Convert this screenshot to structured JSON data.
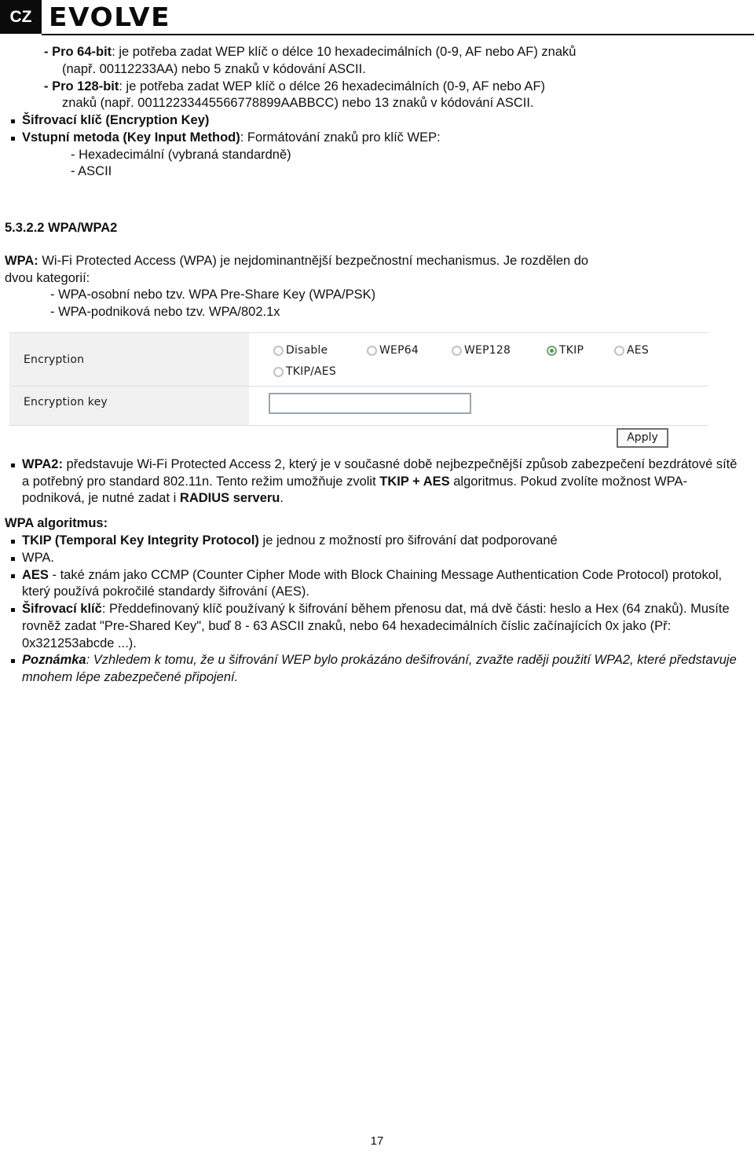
{
  "header": {
    "country_badge": "CZ",
    "brand": "EVOLVE"
  },
  "wep_key_lengths": {
    "bit64": {
      "label": "- Pro 64-bit",
      "line1_rest": ": je potřeba zadat WEP klíč o délce 10 hexadecimálních (0-9, AF nebo AF) znaků",
      "line2": "(např. 00112233AA) nebo 5 znaků v kódování ASCII."
    },
    "bit128": {
      "label": "- Pro 128-bit",
      "line1_rest": ": je potřeba zadat WEP klíč o délce 26 hexadecimálních (0-9, AF nebo AF)",
      "line2": "znaků (např. 00112233445566778899AABBCC) nebo 13 znaků v kódování ASCII."
    }
  },
  "encryption_key_section": {
    "bullet1": "Šifrovací klíč (Encryption Key)",
    "bullet2_bold": "Vstupní metoda (Key Input Method)",
    "bullet2_rest": ": Formátování znaků pro klíč WEP:",
    "sub1": "- Hexadecimální (vybraná standardně)",
    "sub2": "- ASCII"
  },
  "wpa_section": {
    "heading": "5.3.2.2 WPA/WPA2",
    "intro_bold": "WPA:",
    "intro_rest": " Wi-Fi Protected Access (WPA) je nejdominantnější bezpečnostní mechanismus. Je rozdělen do",
    "intro_line2": "dvou kategorií:",
    "cat1": "- WPA-osobní nebo tzv. WPA Pre-Share Key (WPA/PSK)",
    "cat2": "- WPA-podniková nebo tzv. WPA/802.1x"
  },
  "router_ui": {
    "row1_label": "Encryption",
    "row2_label": "Encryption key",
    "encryption_options": [
      {
        "label": "Disable",
        "selected": false
      },
      {
        "label": "WEP64",
        "selected": false
      },
      {
        "label": "WEP128",
        "selected": false
      },
      {
        "label": "TKIP",
        "selected": true
      },
      {
        "label": "AES",
        "selected": false
      },
      {
        "label": "TKIP/AES",
        "selected": false
      }
    ],
    "encryption_key_value": "",
    "apply_button": "Apply",
    "selected_radio_color": "#36a536",
    "label_cell_bg": "#f1f1f1"
  },
  "wpa2_paragraph": {
    "bold_lead": "WPA2:",
    "part1": " představuje Wi-Fi Protected Access 2, který je v současné době nejbezpečnější způsob zabezpečení bezdrátové sítě a potřebný pro standard 802.11n. Tento režim umožňuje zvolit ",
    "bold_tkip": "TKIP + AES",
    "part2": " algoritmus. Pokud zvolíte možnost WPA-podniková, je nutné zadat i ",
    "bold_radius": "RADIUS serveru",
    "part3": "."
  },
  "wpa_algorithms": {
    "heading": "WPA algoritmus:",
    "items": [
      {
        "bold": "TKIP (Temporal Key Integrity Protocol)",
        "rest": " je jednou z možností pro šifrování dat podporované"
      },
      {
        "bold": "WPA.",
        "rest": ""
      },
      {
        "bold": "AES",
        "rest": " - také znám jako CCMP (Counter Cipher Mode with Block Chaining Message Authentication Code Protocol) protokol, který používá pokročilé standardy šifrování (AES)."
      },
      {
        "bold": "Šifrovací klíč",
        "rest": ": Předdefinovaný klíč používaný k šifrování během přenosu dat, má dvě části: heslo a Hex (64 znaků). Musíte rovněž zadat \"Pre-Shared Key\", buď 8 - 63 ASCII znaků, nebo 64 hexadecimálních číslic začínajících 0x jako (Př: 0x321253abcde ...)."
      }
    ],
    "note_bold": "Poznámka",
    "note_rest": ": Vzhledem k tomu, že u šifrování WEP bylo prokázáno dešifrování, zvažte raději použití WPA2, které představuje mnohem lépe zabezpečené připojení."
  },
  "footer": {
    "page_number": "17"
  }
}
